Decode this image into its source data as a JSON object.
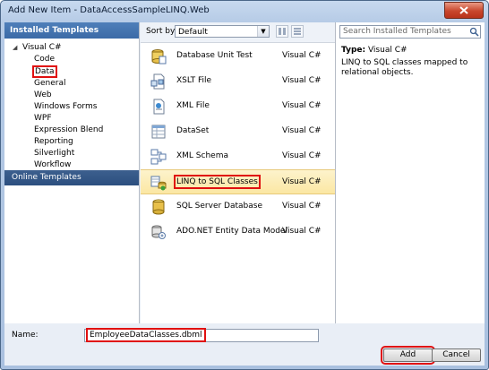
{
  "window": {
    "title": "Add New Item - DataAccessSampleLINQ.Web",
    "close_glyph": "x"
  },
  "left": {
    "header": "Installed Templates",
    "tree": [
      {
        "label": "Visual C#",
        "expander": "◢",
        "level": 0
      },
      {
        "label": "Code",
        "level": 1
      },
      {
        "label": "Data",
        "level": 1,
        "highlighted": true
      },
      {
        "label": "General",
        "level": 1
      },
      {
        "label": "Web",
        "level": 1
      },
      {
        "label": "Windows Forms",
        "level": 1
      },
      {
        "label": "WPF",
        "level": 1
      },
      {
        "label": "Expression Blend",
        "level": 1
      },
      {
        "label": "Reporting",
        "level": 1
      },
      {
        "label": "Silverlight",
        "level": 1
      },
      {
        "label": "Workflow",
        "level": 1
      }
    ],
    "online": "Online Templates"
  },
  "toolbar": {
    "sort_label": "Sort by:",
    "sort_value": "Default"
  },
  "items": [
    {
      "name": "Database Unit Test",
      "type": "Visual C#",
      "icon": "database-unit-test-icon"
    },
    {
      "name": "XSLT File",
      "type": "Visual C#",
      "icon": "xslt-file-icon"
    },
    {
      "name": "XML File",
      "type": "Visual C#",
      "icon": "xml-file-icon"
    },
    {
      "name": "DataSet",
      "type": "Visual C#",
      "icon": "dataset-icon"
    },
    {
      "name": "XML Schema",
      "type": "Visual C#",
      "icon": "xml-schema-icon"
    },
    {
      "name": "LINQ to SQL Classes",
      "type": "Visual C#",
      "icon": "linq-to-sql-icon",
      "selected": true
    },
    {
      "name": "SQL Server Database",
      "type": "Visual C#",
      "icon": "sql-server-database-icon"
    },
    {
      "name": "ADO.NET Entity Data Model",
      "type": "Visual C#",
      "icon": "entity-data-model-icon"
    }
  ],
  "right": {
    "search_placeholder": "Search Installed Templates",
    "type_label": "Type:",
    "type_value": "Visual C#",
    "description": "LINQ to SQL classes mapped to relational objects."
  },
  "bottom": {
    "name_label": "Name:",
    "name_value": "EmployeeDataClasses.dbml",
    "add_label": "Add",
    "cancel_label": "Cancel"
  },
  "colors": {
    "highlight": "#e01010",
    "selected_row": "#fbe7a3",
    "header": "#3b6aa6"
  }
}
